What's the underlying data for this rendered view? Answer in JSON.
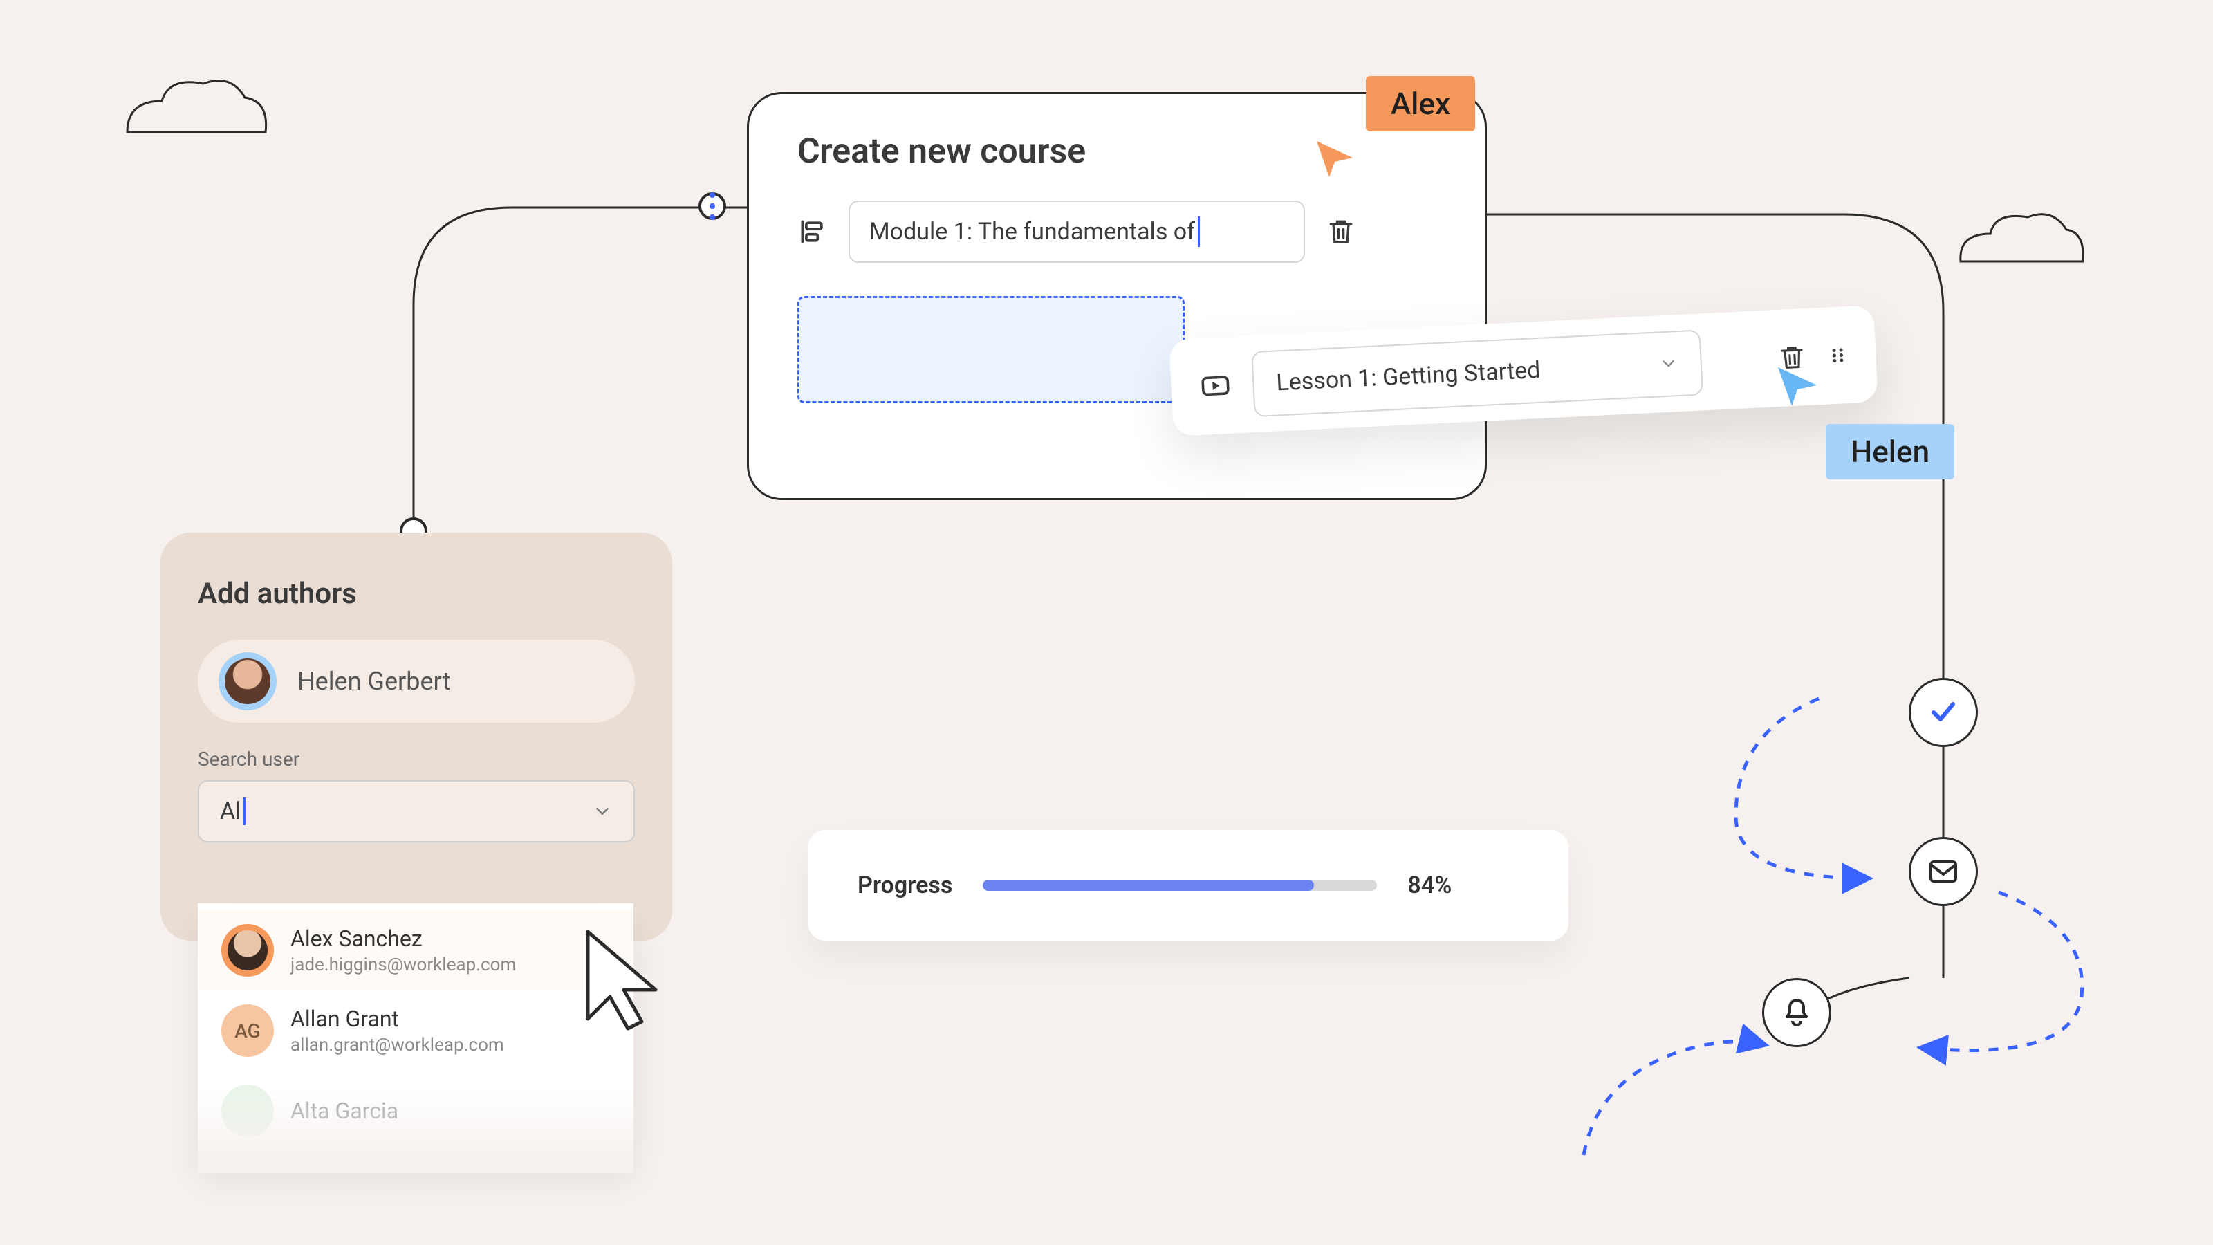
{
  "course": {
    "title": "Create new course",
    "module_input": "Module 1: The fundamentals of",
    "lesson_select": "Lesson 1: Getting Started"
  },
  "cursors": {
    "alex": "Alex",
    "helen": "Helen"
  },
  "authors": {
    "title": "Add authors",
    "selected_name": "Helen Gerbert",
    "search_label": "Search user",
    "search_value": "Al",
    "results": [
      {
        "name": "Alex Sanchez",
        "email": "jade.higgins@workleap.com",
        "initials": ""
      },
      {
        "name": "Allan Grant",
        "email": "allan.grant@workleap.com",
        "initials": "AG"
      },
      {
        "name": "Alta Garcia",
        "email": "",
        "initials": ""
      }
    ]
  },
  "progress": {
    "label": "Progress",
    "percent": 84,
    "percent_label": "84%"
  },
  "colors": {
    "accent_blue": "#3a62ff",
    "tag_orange": "#f5985b",
    "tag_blue": "#a6d2fa",
    "progress_fill": "#6b82f0"
  },
  "icons": {
    "align": "align-left-icon",
    "trash": "trash-icon",
    "video": "video-play-icon",
    "grip": "drag-grip-icon",
    "chevron": "chevron-down-icon",
    "check": "check-icon",
    "mail": "mail-icon",
    "bell": "bell-icon"
  }
}
